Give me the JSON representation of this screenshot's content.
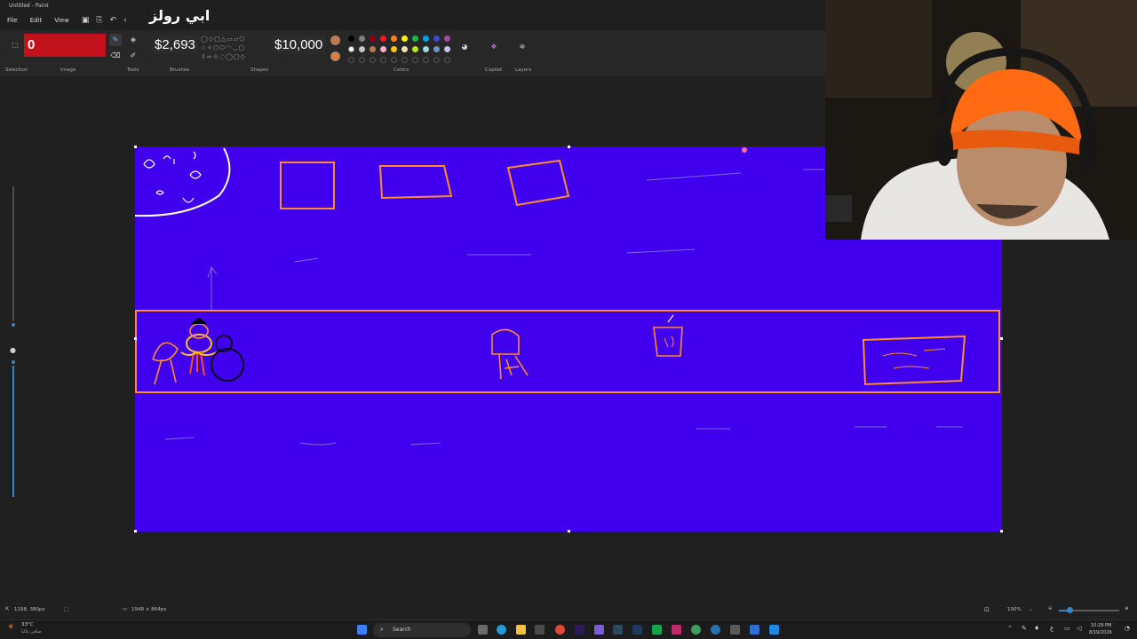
{
  "window": {
    "title": "Untitled - Paint"
  },
  "overlay": {
    "title": "ابي رولز"
  },
  "menu": {
    "file": "File",
    "edit": "Edit",
    "view": "View"
  },
  "ribbon": {
    "counter": "0",
    "money_left": "$2,693",
    "money_right": "$10,000",
    "groups": {
      "selection": "Selection",
      "image": "Image",
      "tools": "Tools",
      "brushes": "Brushes",
      "shapes": "Shapes",
      "colors": "Colors",
      "copilot": "Copilot",
      "layers": "Layers"
    },
    "palette": [
      "#000000",
      "#7f7f7f",
      "#880015",
      "#ed1c24",
      "#ff7f27",
      "#fff200",
      "#22b14c",
      "#00a2e8",
      "#3f48cc",
      "#a349a4",
      "#ffffff",
      "#c3c3c3",
      "#b97a57",
      "#ffaec9",
      "#ffc90e",
      "#efe4b0",
      "#b5e61d",
      "#99d9ea",
      "#7092be",
      "#c8bfe7"
    ],
    "primary_color": "#e07b39",
    "secondary_color": "#4000ee"
  },
  "canvas": {
    "background": "#4000ee",
    "stroke": "#ff8c2a"
  },
  "statusbar": {
    "cursor_pos": "1198, 380px",
    "canvas_size": "1948 × 864px",
    "zoom": "100%"
  },
  "taskbar": {
    "weather_temp": "33°C",
    "weather_desc": "صافي غالبا",
    "search_placeholder": "Search",
    "time": "10:29 PM",
    "date": "8/19/2026"
  }
}
